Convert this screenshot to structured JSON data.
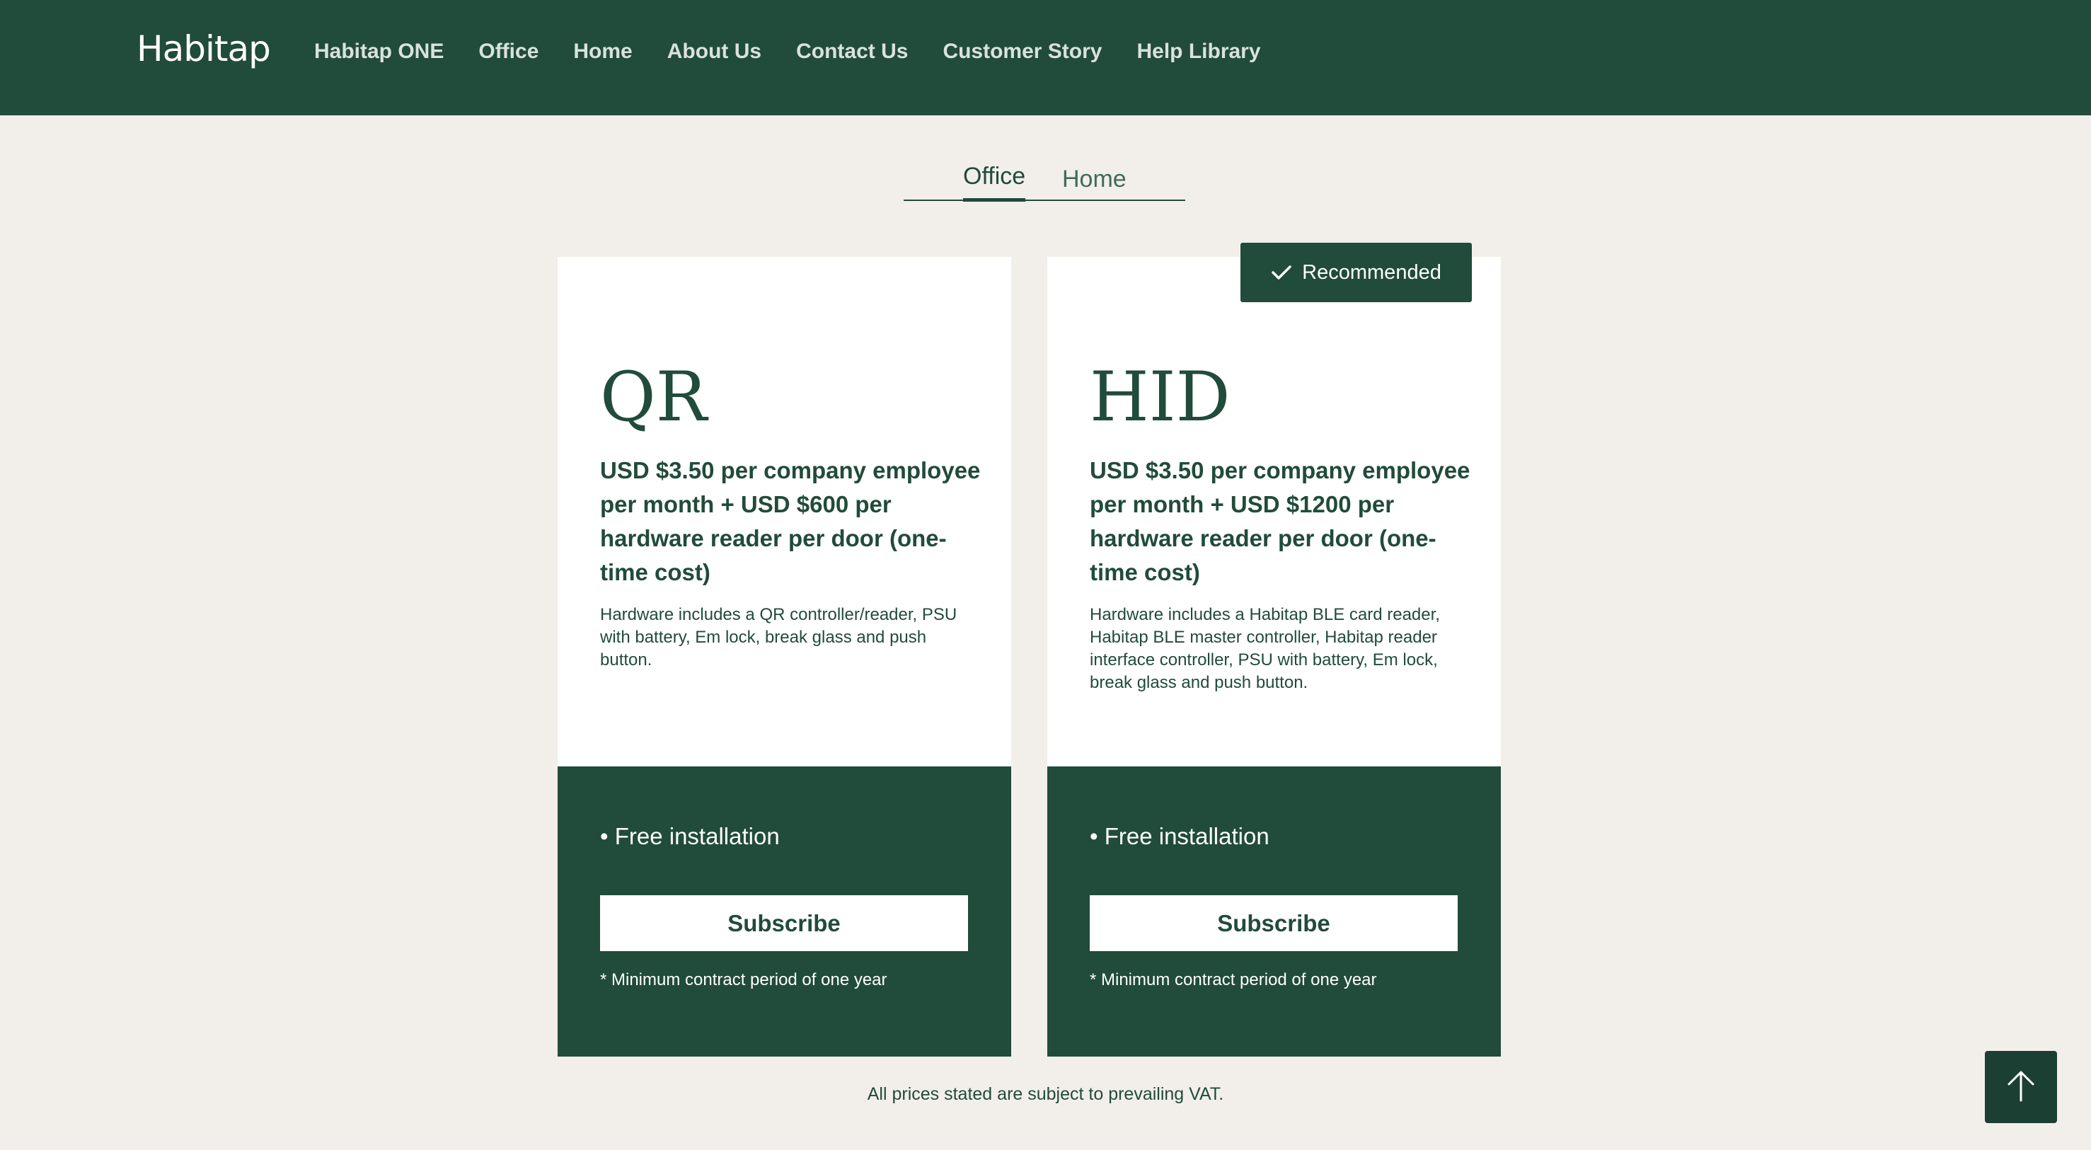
{
  "header": {
    "logo": "Habitap",
    "nav": [
      {
        "label": "Habitap ONE"
      },
      {
        "label": "Office"
      },
      {
        "label": "Home"
      },
      {
        "label": "About Us"
      },
      {
        "label": "Contact Us"
      },
      {
        "label": "Customer Story"
      },
      {
        "label": "Help Library"
      }
    ]
  },
  "tabs": {
    "office": "Office",
    "home": "Home",
    "active": "Office"
  },
  "badge": {
    "label": "Recommended",
    "icon": "checkmark-icon"
  },
  "plans": [
    {
      "name": "QR",
      "price": "USD $3.50 per company employee per month + USD $600 per hardware reader per door (one-time cost)",
      "description": "Hardware includes a QR controller/reader, PSU with battery, Em lock, break glass and push button.",
      "feature": "• Free installation",
      "button": "Subscribe",
      "note": "* Minimum contract period of one year"
    },
    {
      "name": "HID",
      "price": "USD $3.50 per company employee per month + USD $1200 per hardware reader per door (one-time cost)",
      "description": "Hardware includes a Habitap BLE card reader, Habitap BLE master controller, Habitap reader interface controller, PSU with battery, Em lock, break glass and push button.",
      "feature": "• Free installation",
      "button": "Subscribe",
      "note": "* Minimum contract period of one year"
    }
  ],
  "footer": {
    "vat_note": "All prices stated are subject to prevailing VAT."
  },
  "back_to_top": {
    "icon": "arrow-up-icon"
  },
  "colors": {
    "brand": "#214b3b",
    "background": "#f2efeb",
    "card": "#ffffff"
  }
}
